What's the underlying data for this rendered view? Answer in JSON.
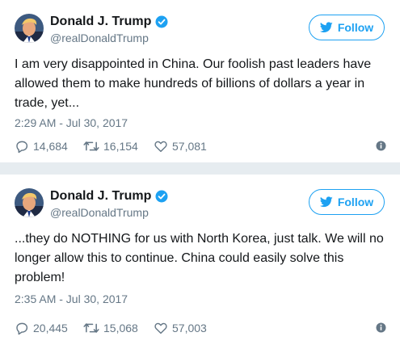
{
  "colors": {
    "accent": "#1da1f2",
    "text": "#14171a",
    "secondary": "#657786",
    "separator": "#e6ecf0"
  },
  "tweets": [
    {
      "author": {
        "name": "Donald J. Trump",
        "handle": "@realDonaldTrump",
        "verified": true,
        "avatar_icon": "profile-photo"
      },
      "follow_label": "Follow",
      "text": "I am very disappointed in China. Our foolish past leaders have allowed them to make hundreds of billions of dollars a year in trade, yet...",
      "timestamp": "2:29 AM - Jul 30, 2017",
      "replies": "14,684",
      "retweets": "16,154",
      "likes": "57,081"
    },
    {
      "author": {
        "name": "Donald J. Trump",
        "handle": "@realDonaldTrump",
        "verified": true,
        "avatar_icon": "profile-photo"
      },
      "follow_label": "Follow",
      "text": "...they do NOTHING for us with North Korea, just talk. We will no longer allow this to continue. China could easily solve this problem!",
      "timestamp": "2:35 AM - Jul 30, 2017",
      "replies": "20,445",
      "retweets": "15,068",
      "likes": "57,003"
    }
  ]
}
